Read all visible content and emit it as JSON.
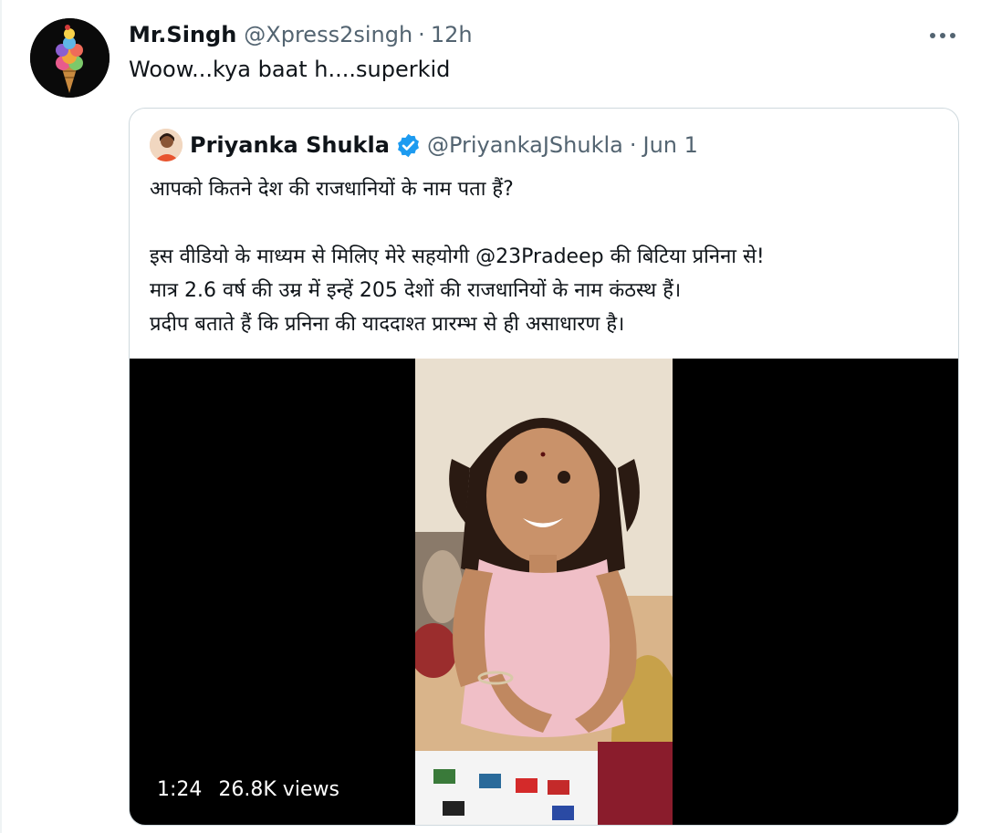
{
  "tweet": {
    "display_name": "Mr.Singh",
    "handle": "@Xpress2singh",
    "separator": "·",
    "time": "12h",
    "text": "Woow...kya baat h....superkid",
    "avatar_icon": "ice-cream-cone-avatar",
    "more_icon": "more-dots-icon"
  },
  "quoted": {
    "display_name": "Priyanka Shukla",
    "verified_icon": "verified-badge-icon",
    "verified_color": "#1d9bf0",
    "handle": "@PriyankaJShukla",
    "separator": "·",
    "time": "Jun 1",
    "text_lines": [
      "आपको कितने देश की राजधानियों के नाम पता  हैं?",
      "इस वीडियो के माध्यम से मिलिए मेरे सहयोगी @23Pradeep की बिटिया प्रनिना से!",
      "मात्र 2.6 वर्ष की उम्र में इन्हें 205 देशों की राजधानियों के नाम कंठस्थ हैं।",
      "प्रदीप बताते हैं कि प्रनिना की याददाश्त प्रारम्भ से ही असाधारण है।"
    ],
    "video": {
      "duration": "1:24",
      "views": "26.8K views"
    }
  }
}
